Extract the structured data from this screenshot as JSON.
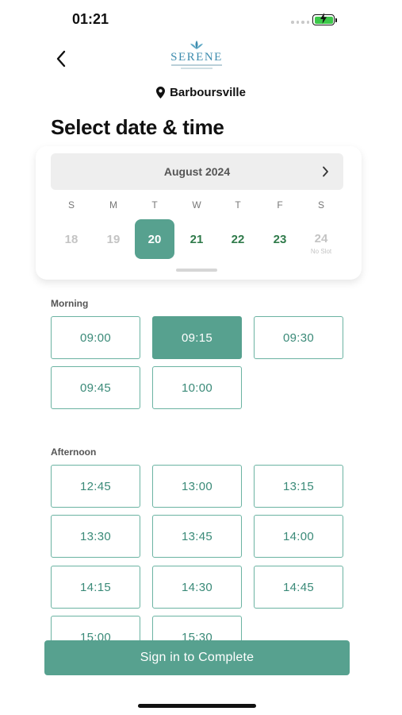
{
  "status_bar": {
    "time": "01:21"
  },
  "header": {
    "logo_text": "SERENE"
  },
  "location": {
    "name": "Barboursville"
  },
  "page": {
    "title": "Select date & time"
  },
  "calendar": {
    "month_label": "August 2024",
    "weekdays": [
      "S",
      "M",
      "T",
      "W",
      "T",
      "F",
      "S"
    ],
    "days": [
      {
        "num": "18",
        "state": "past",
        "note": ""
      },
      {
        "num": "19",
        "state": "past",
        "note": ""
      },
      {
        "num": "20",
        "state": "selected",
        "note": ""
      },
      {
        "num": "21",
        "state": "available",
        "note": ""
      },
      {
        "num": "22",
        "state": "available",
        "note": ""
      },
      {
        "num": "23",
        "state": "available",
        "note": ""
      },
      {
        "num": "24",
        "state": "noslot",
        "note": "No Slot"
      }
    ]
  },
  "morning": {
    "label": "Morning",
    "slots": [
      {
        "time": "09:00",
        "selected": false
      },
      {
        "time": "09:15",
        "selected": true
      },
      {
        "time": "09:30",
        "selected": false
      },
      {
        "time": "09:45",
        "selected": false
      },
      {
        "time": "10:00",
        "selected": false
      }
    ]
  },
  "afternoon": {
    "label": "Afternoon",
    "slots": [
      {
        "time": "12:45",
        "selected": false
      },
      {
        "time": "13:00",
        "selected": false
      },
      {
        "time": "13:15",
        "selected": false
      },
      {
        "time": "13:30",
        "selected": false
      },
      {
        "time": "13:45",
        "selected": false
      },
      {
        "time": "14:00",
        "selected": false
      },
      {
        "time": "14:15",
        "selected": false
      },
      {
        "time": "14:30",
        "selected": false
      },
      {
        "time": "14:45",
        "selected": false
      },
      {
        "time": "15:00",
        "selected": false
      },
      {
        "time": "15:30",
        "selected": false
      }
    ]
  },
  "cta": {
    "label": "Sign in to Complete"
  },
  "colors": {
    "accent": "#57a18f",
    "available_day": "#2f7a4a",
    "slot_text": "#3a8a78"
  },
  "icons": {
    "back": "chevron-left-icon",
    "location": "map-pin-icon",
    "next_month": "chevron-right-icon",
    "battery": "battery-charging-icon"
  }
}
